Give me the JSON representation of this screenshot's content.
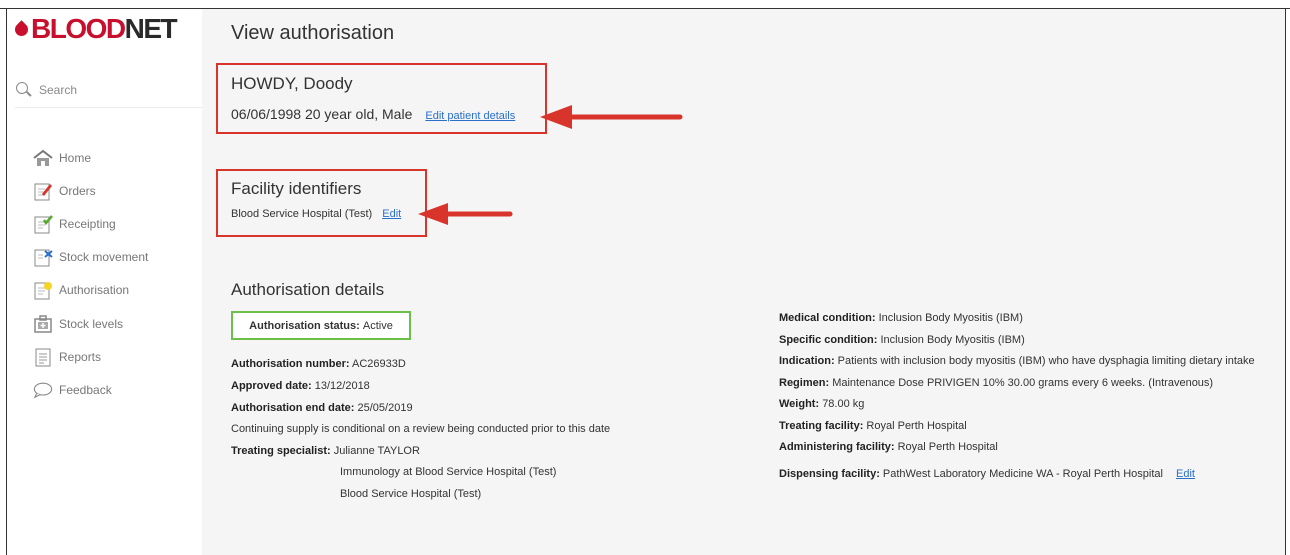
{
  "brand": {
    "part1": "BLOOD",
    "part2": "NET"
  },
  "search": {
    "label": "Search"
  },
  "nav": {
    "home": "Home",
    "orders": "Orders",
    "receipting": "Receipting",
    "stock_movement": "Stock movement",
    "authorisation": "Authorisation",
    "stock_levels": "Stock levels",
    "reports": "Reports",
    "feedback": "Feedback"
  },
  "page": {
    "title": "View authorisation"
  },
  "patient": {
    "name": "HOWDY, Doody",
    "details": "06/06/1998 20 year old, Male",
    "edit_link": "Edit patient details"
  },
  "facility": {
    "title": "Facility identifiers",
    "name": "Blood Service Hospital (Test)",
    "edit_link": "Edit"
  },
  "authorisation": {
    "title": "Authorisation details",
    "status_label": "Authorisation status:",
    "status_value": "Active",
    "number_label": "Authorisation number:",
    "number_value": "AC26933D",
    "approved_label": "Approved date:",
    "approved_value": "13/12/2018",
    "end_label": "Authorisation end date:",
    "end_value": "25/05/2019",
    "supply_note": "Continuing supply is conditional on a review being conducted prior to this date",
    "specialist_label": "Treating specialist:",
    "specialist_name": "Julianne TAYLOR",
    "specialist_unit": "Immunology at Blood Service Hospital (Test)",
    "specialist_hospital": "Blood Service Hospital (Test)",
    "medical_label": "Medical condition:",
    "medical_value": "Inclusion Body Myositis (IBM)",
    "specific_label": "Specific condition:",
    "specific_value": "Inclusion Body Myositis (IBM)",
    "indication_label": "Indication:",
    "indication_value": "Patients with inclusion body myositis (IBM) who have dysphagia limiting dietary intake",
    "regimen_label": "Regimen:",
    "regimen_value": "Maintenance Dose PRIVIGEN 10% 30.00 grams every 6 weeks. (Intravenous)",
    "weight_label": "Weight:",
    "weight_value": "78.00 kg",
    "treating_facility_label": "Treating facility:",
    "treating_facility_value": "Royal Perth Hospital",
    "administering_label": "Administering facility:",
    "administering_value": "Royal Perth Hospital",
    "dispensing_label": "Dispensing facility:",
    "dispensing_value": "PathWest Laboratory Medicine WA - Royal Perth Hospital",
    "dispensing_edit": "Edit"
  },
  "colors": {
    "brand_red": "#c8102e",
    "highlight_red": "#d9342b",
    "status_green": "#6cc04a",
    "link_blue": "#2a6fcc"
  }
}
